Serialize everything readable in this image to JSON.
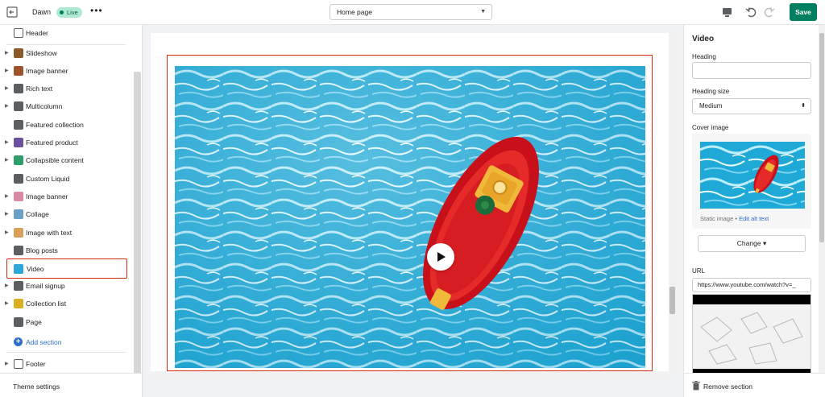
{
  "topbar": {
    "theme_name": "Dawn",
    "live_badge": "Live",
    "more_label": "•••",
    "page_select": "Home page",
    "save_label": "Save"
  },
  "sidebar": {
    "header_item": "Header",
    "items": [
      {
        "label": "Slideshow",
        "icon": "slideshow-icon",
        "color": "#8b5a2b"
      },
      {
        "label": "Image banner",
        "icon": "image-banner-icon",
        "color": "#a0522d"
      },
      {
        "label": "Rich text",
        "icon": "rich-text-icon",
        "color": "#5c5f62"
      },
      {
        "label": "Multicolumn",
        "icon": "multicolumn-icon",
        "color": "#5c5f62"
      },
      {
        "label": "Featured collection",
        "icon": "collection-icon",
        "color": "#5c5f62"
      },
      {
        "label": "Featured product",
        "icon": "product-icon",
        "color": "#6b4fa0"
      },
      {
        "label": "Collapsible content",
        "icon": "collapsible-icon",
        "color": "#2e9e6b"
      },
      {
        "label": "Custom Liquid",
        "icon": "liquid-icon",
        "color": "#5c5f62"
      },
      {
        "label": "Image banner",
        "icon": "image-banner-icon",
        "color": "#d98aa0"
      },
      {
        "label": "Collage",
        "icon": "collage-icon",
        "color": "#6aa0c8"
      },
      {
        "label": "Image with text",
        "icon": "image-text-icon",
        "color": "#d9a05a"
      },
      {
        "label": "Blog posts",
        "icon": "blog-icon",
        "color": "#5c5f62"
      },
      {
        "label": "Video",
        "icon": "video-icon",
        "color": "#2ba8d9"
      },
      {
        "label": "Email signup",
        "icon": "email-icon",
        "color": "#5c5f62"
      },
      {
        "label": "Collection list",
        "icon": "collection-list-icon",
        "color": "#d9b020"
      },
      {
        "label": "Page",
        "icon": "page-icon",
        "color": "#5c5f62"
      }
    ],
    "add_section": "Add section",
    "footer_item": "Footer",
    "theme_settings": "Theme settings"
  },
  "editor": {
    "title": "Video",
    "heading_label": "Heading",
    "heading_value": "",
    "heading_size_label": "Heading size",
    "heading_size_value": "Medium",
    "cover_image_label": "Cover image",
    "static_image": "Static image • ",
    "edit_alt": "Edit alt text",
    "change_label": "Change",
    "url_label": "URL",
    "url_value": "https://www.youtube.com/watch?v=_",
    "remove_section": "Remove section"
  },
  "colors": {
    "accent_green": "#008060",
    "selection_red": "#d72c0d",
    "link_blue": "#2c6ecb"
  }
}
